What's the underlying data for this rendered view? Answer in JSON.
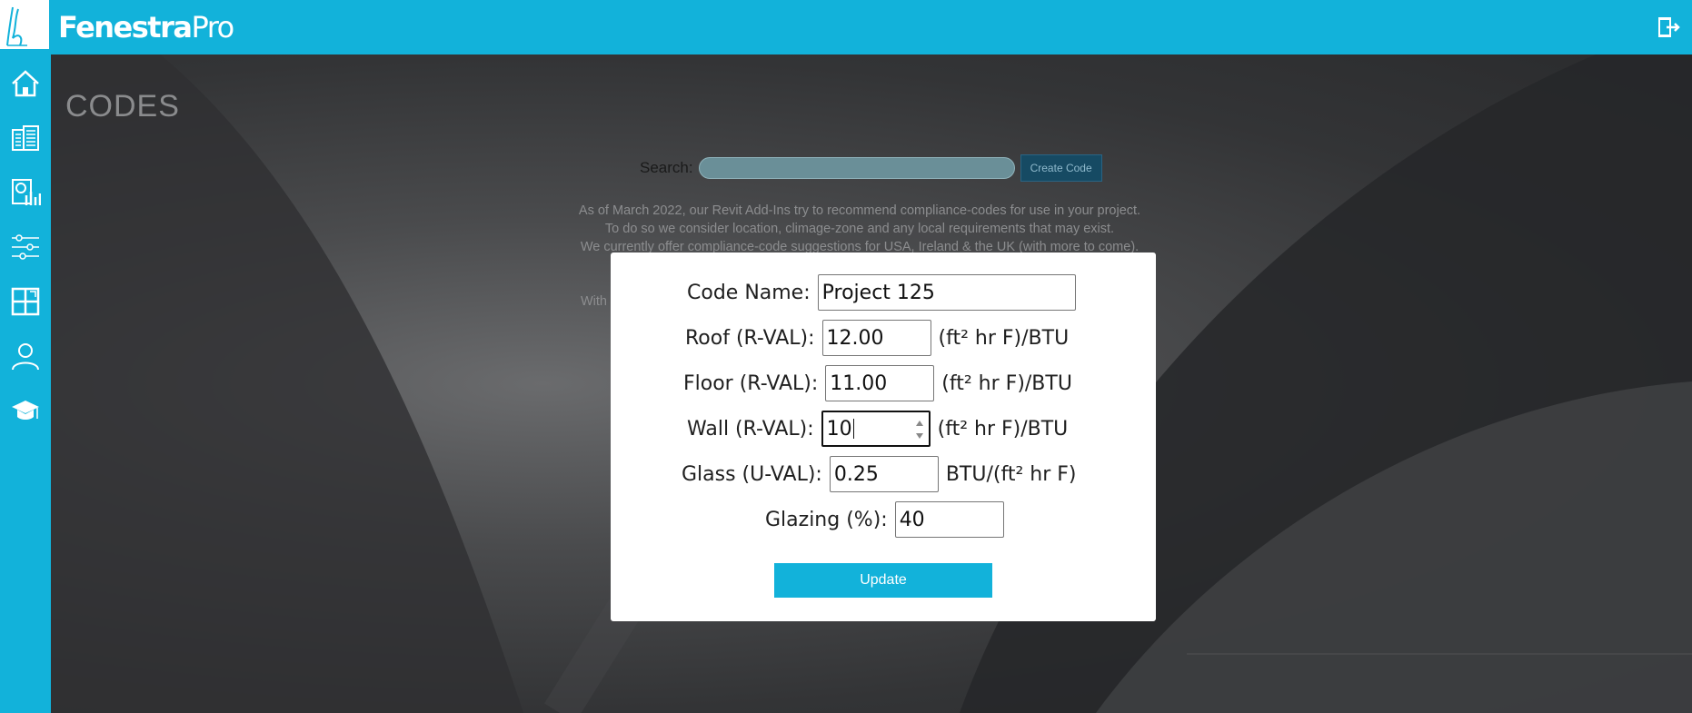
{
  "brand": {
    "name_bold": "Fenestra",
    "name_light": "Pro"
  },
  "colors": {
    "accent": "#12b2da",
    "modal_bg": "#ffffff",
    "create_button": "#164a63"
  },
  "header": {
    "exit_icon": "exit-icon"
  },
  "sidebar": {
    "items": [
      {
        "icon": "home-icon"
      },
      {
        "icon": "buildings-icon"
      },
      {
        "icon": "reports-icon"
      },
      {
        "icon": "settings-sliders-icon"
      },
      {
        "icon": "windows-icon"
      },
      {
        "icon": "user-icon"
      },
      {
        "icon": "graduation-cap-icon"
      }
    ]
  },
  "page": {
    "title": "CODES",
    "search_label": "Search:",
    "search_value": "",
    "create_button": "Create Code",
    "info_lines": [
      "As of March 2022, our Revit Add-Ins try to recommend compliance-codes for use in your project.",
      "To do so we consider location, climage-zone and any local requirements that may exist.",
      "We currently offer compliance-code suggestions for USA, Ireland & the UK (with more to come)."
    ],
    "with_text": "With"
  },
  "modal": {
    "code_name_label": "Code Name:",
    "code_name_value": "Project 125",
    "roof_label": "Roof (R-VAL):",
    "roof_value": "12.00",
    "roof_unit": "(ft² hr F)/BTU",
    "floor_label": "Floor (R-VAL):",
    "floor_value": "11.00",
    "floor_unit": "(ft² hr F)/BTU",
    "wall_label": "Wall (R-VAL):",
    "wall_value": "10",
    "wall_unit": "(ft² hr F)/BTU",
    "glass_label": "Glass (U-VAL):",
    "glass_value": "0.25",
    "glass_unit": "BTU/(ft² hr F)",
    "glazing_label": "Glazing (%):",
    "glazing_value": "40",
    "update_button": "Update"
  }
}
